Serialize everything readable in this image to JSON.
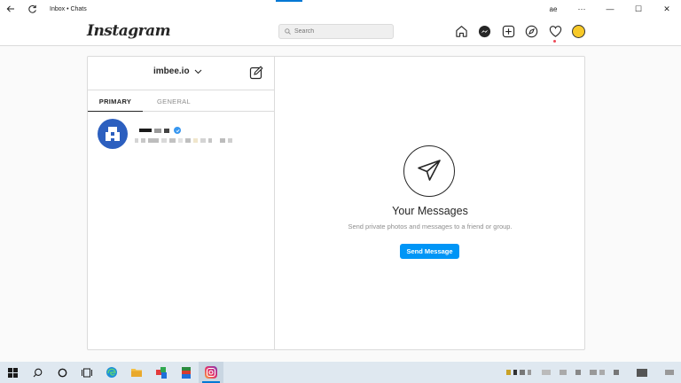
{
  "window": {
    "title": "Inbox • Chats",
    "controls": {
      "minimize": "—",
      "maximize": "☐",
      "close": "✕"
    },
    "extras": {
      "menu": "···",
      "profile": "ae"
    }
  },
  "topnav": {
    "logo": "Instagram",
    "search_placeholder": "Search",
    "icons": [
      "home-icon",
      "messenger-icon",
      "new-post-icon",
      "explore-icon",
      "activity-heart-icon",
      "profile-avatar"
    ]
  },
  "inbox": {
    "username": "imbee.io",
    "tabs": [
      {
        "label": "PRIMARY",
        "active": true
      },
      {
        "label": "GENERAL",
        "active": false
      }
    ]
  },
  "messages": {
    "title": "Your Messages",
    "subtitle": "Send private photos and messages to a friend or group.",
    "button": "Send Message"
  },
  "colors": {
    "accent": "#0095f6",
    "border": "#dbdbdb",
    "notification": "#ed4956",
    "taskbar": "#dfe8f0"
  }
}
